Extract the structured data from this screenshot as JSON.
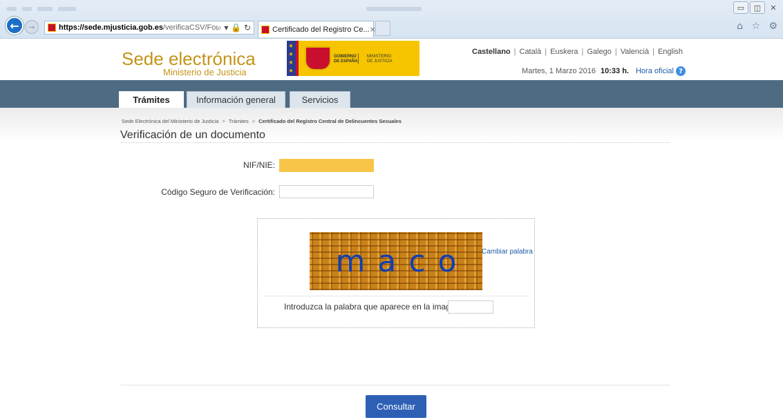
{
  "browser": {
    "address_url_domain": "https://sede.mjusticia.gob.es",
    "address_url_path": "/verificaCSV/Formular",
    "address_controls": "⌕ ▾ 🔒 ↻",
    "tab_title": "Certificado del Registro Ce...",
    "tab_close": "×",
    "window_buttons": [
      "▭",
      "◫",
      "✕"
    ],
    "right_icons": "⌂ ☆ ⚙"
  },
  "header": {
    "logo_title": "Sede electrónica",
    "logo_subtitle": "Ministerio de Justicia",
    "gov_line1": "GOBIERNO",
    "gov_line2": "DE ESPAÑA",
    "gov_ministry1": "MINISTERIO",
    "gov_ministry2": "DE JUSTICIA",
    "languages": [
      {
        "label": "Castellano",
        "active": true
      },
      {
        "label": "Català"
      },
      {
        "label": "Euskera"
      },
      {
        "label": "Galego"
      },
      {
        "label": "Valencià"
      },
      {
        "label": "English"
      }
    ],
    "date": "Martes, 1 Marzo 2016",
    "time": "10:33 h.",
    "official_time_link": "Hora oficial",
    "help_glyph": "?"
  },
  "nav": {
    "tabs": [
      {
        "label": "Trámites",
        "active": true
      },
      {
        "label": "Información general"
      },
      {
        "label": "Servicios"
      }
    ]
  },
  "breadcrumb": {
    "items": [
      "Sede Electrónica del Ministerio de Justicia",
      "Trámites",
      "Certificado del Registro Central de Delincuentes Sexuales"
    ],
    "separator": ">"
  },
  "page": {
    "title": "Verificación de un documento"
  },
  "form": {
    "nif_label": "NIF/NIE:",
    "nif_value": "",
    "csv_label": "Código Seguro de Verificación:",
    "csv_value": ""
  },
  "captcha": {
    "word": "maco",
    "change_link": "Cambiar palabra",
    "prompt": "Introduzca la palabra que aparece en la imagen:",
    "answer": ""
  },
  "actions": {
    "submit_label": "Consultar"
  },
  "colors": {
    "brand_gold": "#c39418",
    "nav_band": "#4e6b82",
    "highlight_field": "#f8c549",
    "button_primary": "#2d5fb5",
    "link": "#1c5aa8"
  }
}
